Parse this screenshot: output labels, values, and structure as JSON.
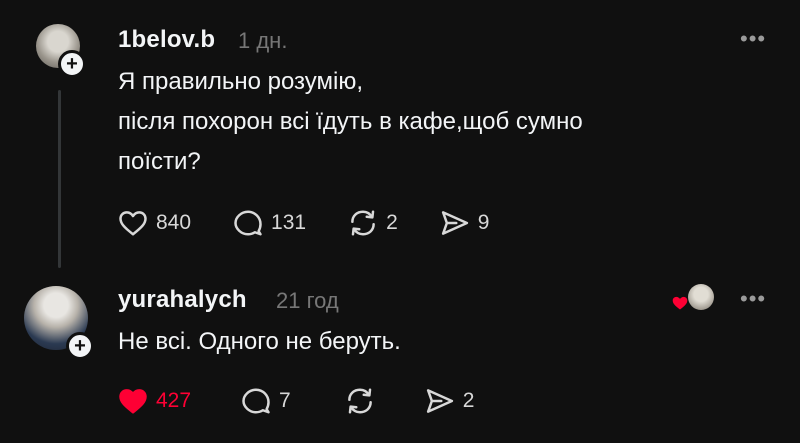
{
  "posts": [
    {
      "username": "1belov.b",
      "time": "1 дн.",
      "more": "•••",
      "plus": "+",
      "lines": [
        "Я правильно розумію,",
        "після похорон всі їдуть в кафе,щоб сумно",
        "поїсти?"
      ],
      "likes": "840",
      "replies": "131",
      "reposts": "2",
      "shares": "9",
      "liked": false
    },
    {
      "username": "yurahalych",
      "time": "21 год",
      "more": "•••",
      "plus": "+",
      "lines": [
        "Не всі. Одного не беруть."
      ],
      "likes": "427",
      "replies": "7",
      "reposts": "",
      "shares": "2",
      "liked": true
    }
  ],
  "colors": {
    "background": "#101010",
    "text": "#f3f5f7",
    "muted": "#777777",
    "like_red": "#fe0034",
    "thread_line": "#333638"
  },
  "icons": [
    "heart-icon",
    "comment-icon",
    "repost-icon",
    "share-icon",
    "more-icon",
    "follow-plus-icon"
  ]
}
